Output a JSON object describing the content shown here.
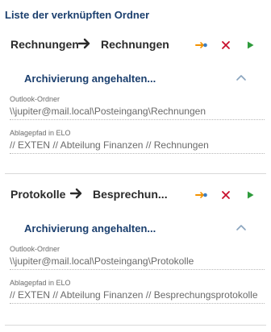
{
  "list_title": "Liste der verknüpften Ordner",
  "folders": [
    {
      "source": "Rechnungen",
      "target": "Rechnungen",
      "status": "Archivierung angehalten...",
      "outlook_label": "Outlook-Ordner",
      "outlook_value": "\\\\jupiter@mail.local\\Posteingang\\Rechnungen",
      "elo_label": "Ablagepfad in ELO",
      "elo_value": "// EXTEN // Abteilung Finanzen // Rechnungen"
    },
    {
      "source": "Protokolle",
      "target": "Besprechun...",
      "status": "Archivierung angehalten...",
      "outlook_label": "Outlook-Ordner",
      "outlook_value": "\\\\jupiter@mail.local\\Posteingang\\Protokolle",
      "elo_label": "Ablagepfad in ELO",
      "elo_value": "// EXTEN // Abteilung Finanzen // Besprechungsprotokolle"
    }
  ],
  "icons": {
    "arrow": "arrow-right-icon",
    "move": "move-icon",
    "delete": "close-icon",
    "play": "play-icon",
    "collapse": "chevron-up-icon"
  },
  "colors": {
    "accent": "#1b3f6e",
    "delete": "#c8102e",
    "play": "#2e9b3c",
    "move_orange": "#f39200",
    "move_blue": "#3d7fc1"
  }
}
